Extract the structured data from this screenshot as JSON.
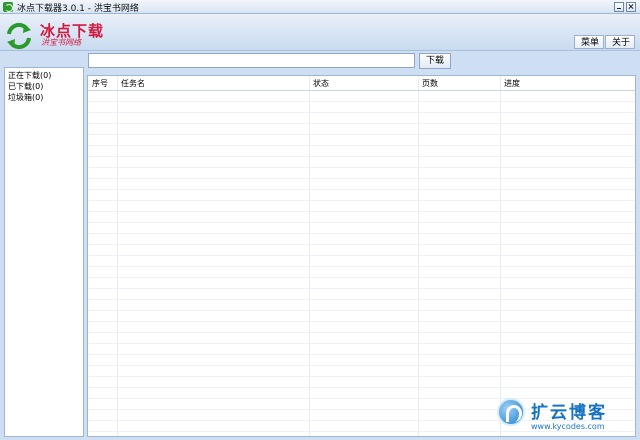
{
  "window": {
    "title": "冰点下载器3.0.1 - 洪宝书网络"
  },
  "header": {
    "logo_title": "冰点下载",
    "logo_subtitle": "洪宝书网络",
    "menu_label": "菜单",
    "about_label": "关于"
  },
  "search": {
    "value": "",
    "placeholder": "",
    "download_label": "下载"
  },
  "sidebar": {
    "items": [
      {
        "label": "正在下载(0)"
      },
      {
        "label": "已下载(0)"
      },
      {
        "label": "垃圾箱(0)"
      }
    ]
  },
  "table": {
    "columns": [
      "序号",
      "任务名",
      "状态",
      "页数",
      "进度"
    ],
    "rows": []
  },
  "watermark": {
    "text": "扩云博客",
    "url": "www.kycodes.com"
  },
  "colors": {
    "brand": "#d3183e",
    "accent": "#1673c4",
    "chrome": "#cfdff3"
  }
}
